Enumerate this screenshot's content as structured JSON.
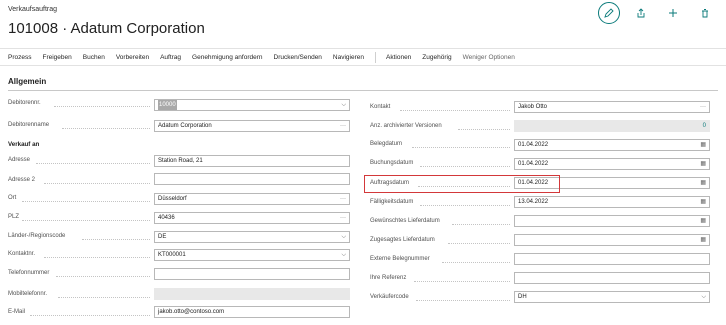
{
  "header": {
    "page_type": "Verkaufsauftrag",
    "title": "101008 · Adatum Corporation"
  },
  "top_actions": [
    {
      "name": "edit-icon",
      "glyph": "✎"
    },
    {
      "name": "share-icon",
      "glyph": "⇪"
    },
    {
      "name": "new-icon",
      "glyph": "+"
    },
    {
      "name": "delete-icon",
      "glyph": "🗑"
    }
  ],
  "actionbar": {
    "items": [
      "Prozess",
      "Freigeben",
      "Buchen",
      "Vorbereiten",
      "Auftrag",
      "Genehmigung anfordern",
      "Drucken/Senden",
      "Navigieren"
    ],
    "items2": [
      "Aktionen",
      "Zugehörig"
    ],
    "fewer_options": "Weniger Optionen"
  },
  "section": {
    "title": "Allgemein"
  },
  "left_fields": {
    "debitorennr": {
      "label": "Debitorennr.",
      "value": "10000"
    },
    "debitorenname": {
      "label": "Debitorenname",
      "value": "Adatum Corporation"
    },
    "verkauf_an": {
      "label": "Verkauf an"
    },
    "adresse": {
      "label": "Adresse",
      "value": "Station Road, 21"
    },
    "adresse2": {
      "label": "Adresse 2",
      "value": ""
    },
    "ort": {
      "label": "Ort",
      "value": "Düsseldorf"
    },
    "plz": {
      "label": "PLZ",
      "value": "40436"
    },
    "laender": {
      "label": "Länder-/Regionscode",
      "value": "DE"
    },
    "kontaktnr": {
      "label": "Kontaktnr.",
      "value": "KT000001"
    },
    "telefon": {
      "label": "Telefonnummer",
      "value": ""
    },
    "mobil": {
      "label": "Mobiltelefonnr.",
      "value": ""
    },
    "email": {
      "label": "E-Mail",
      "value": "jakob.otto@contoso.com"
    }
  },
  "right_fields": {
    "kontakt": {
      "label": "Kontakt",
      "value": "Jakob Otto"
    },
    "anz_versionen": {
      "label": "Anz. archivierter Versionen",
      "value": "0"
    },
    "belegdatum": {
      "label": "Belegdatum",
      "value": "01.04.2022"
    },
    "buchungsdatum": {
      "label": "Buchungsdatum",
      "value": "01.04.2022"
    },
    "auftragsdatum": {
      "label": "Auftragsdatum",
      "value": "01.04.2022"
    },
    "faelligkeitsdatum": {
      "label": "Fälligkeitsdatum",
      "value": "13.04.2022"
    },
    "gew_lieferdatum": {
      "label": "Gewünschtes Lieferdatum",
      "value": ""
    },
    "zug_lieferdatum": {
      "label": "Zugesagtes Lieferdatum",
      "value": ""
    },
    "ext_belegnummer": {
      "label": "Externe Belegnummer",
      "value": ""
    },
    "ihre_referenz": {
      "label": "Ihre Referenz",
      "value": ""
    },
    "verkaeufercode": {
      "label": "Verkäufercode",
      "value": "DH"
    }
  },
  "icons": {
    "lookup": "···",
    "dropdown": "⌵",
    "calendar": "▦"
  }
}
